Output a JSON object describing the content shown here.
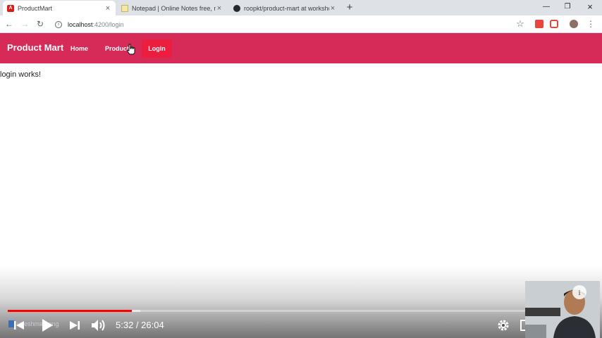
{
  "browser": {
    "tabs": [
      {
        "title": "ProductMart",
        "active": true
      },
      {
        "title": "Notepad | Online Notes free, no",
        "active": false
      },
      {
        "title": "roopkt/product-mart at worksho",
        "active": false
      }
    ],
    "url_host": "localhost",
    "url_path": ":4200/login"
  },
  "app": {
    "brand": "Product Mart",
    "nav": [
      {
        "label": "Home",
        "active": false
      },
      {
        "label": "Product",
        "active": false
      },
      {
        "label": "Login",
        "active": true
      }
    ],
    "content_text": "login works!",
    "colors": {
      "navbar": "#d62a58",
      "active_link": "#ec1e3f"
    }
  },
  "video": {
    "current_time": "5:32",
    "duration": "26:04",
    "time_display": "5:32 / 26:04",
    "progress_fraction": 0.212,
    "buffered_fraction": 0.226,
    "overlay_file": "upeshmari.png"
  }
}
